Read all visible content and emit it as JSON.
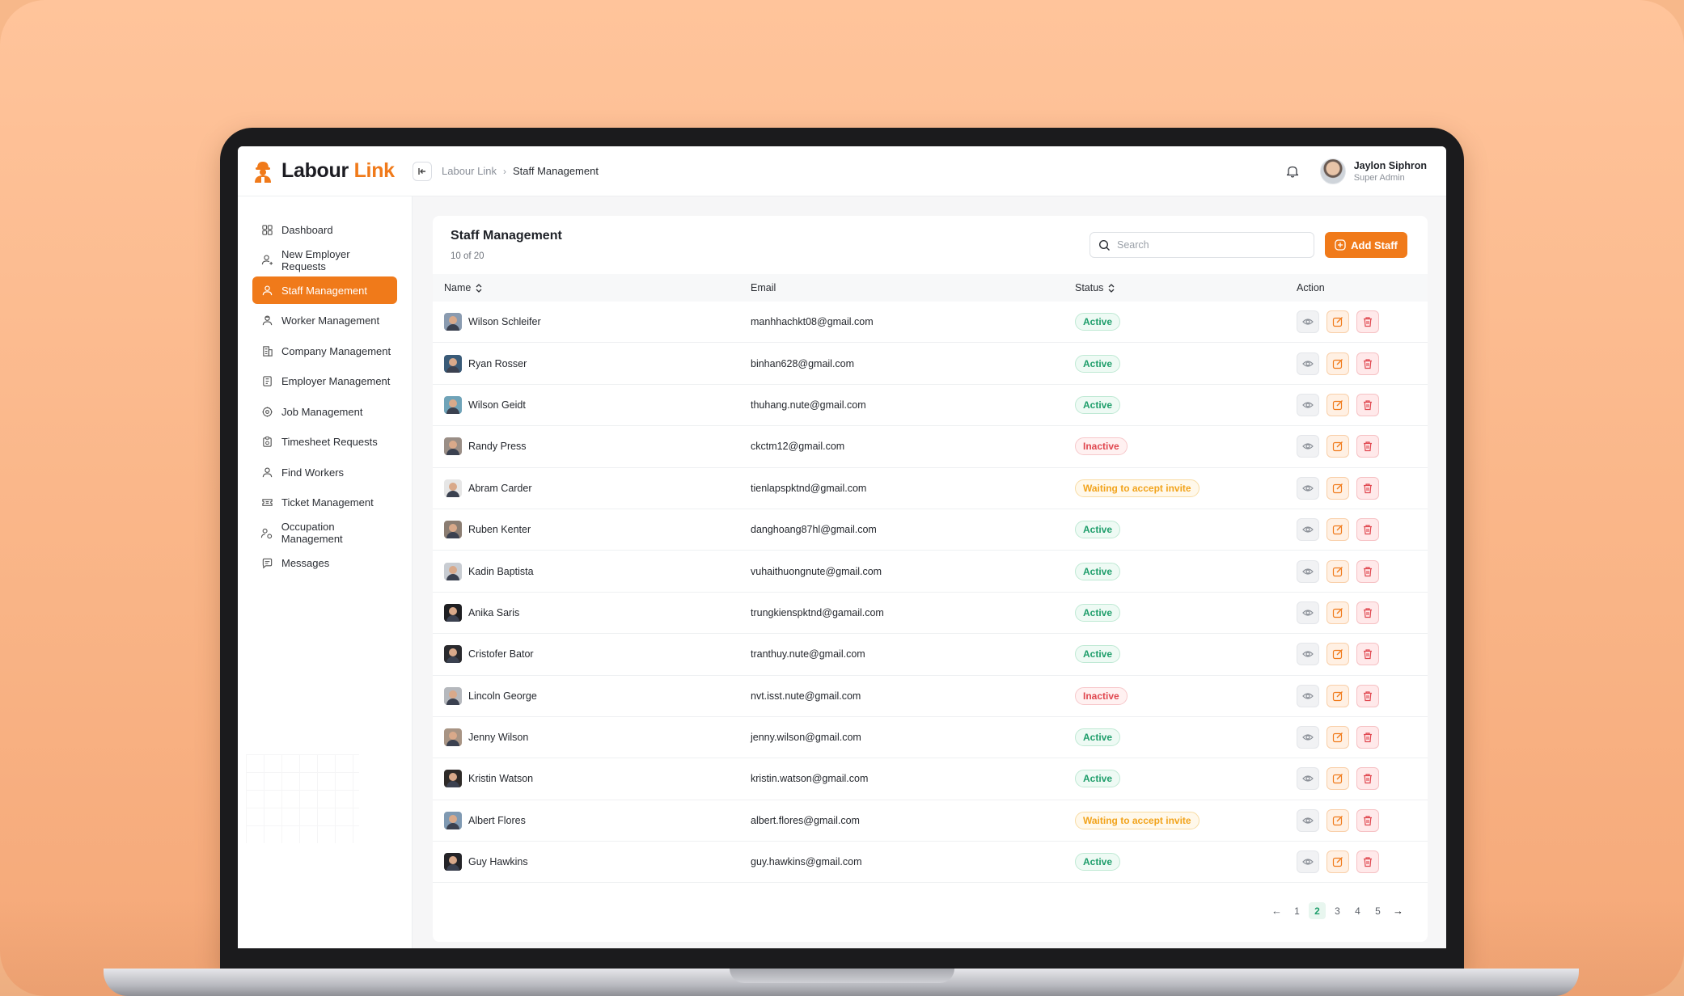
{
  "brand": {
    "name_main": "Labour ",
    "name_accent": "Link",
    "accent_color": "#f07a1a"
  },
  "breadcrumb": {
    "root": "Labour Link",
    "separator": "›",
    "current": "Staff Management"
  },
  "user": {
    "name": "Jaylon Siphron",
    "role": "Super Admin"
  },
  "sidebar": {
    "items": [
      {
        "label": "Dashboard",
        "icon": "dashboard-icon",
        "active": false
      },
      {
        "label": "New Employer Requests",
        "icon": "user-plus-icon",
        "active": false
      },
      {
        "label": "Staff Management",
        "icon": "staff-icon",
        "active": true
      },
      {
        "label": "Worker Management",
        "icon": "worker-icon",
        "active": false
      },
      {
        "label": "Company Management",
        "icon": "building-icon",
        "active": false
      },
      {
        "label": "Employer Management",
        "icon": "briefcase-icon",
        "active": false
      },
      {
        "label": "Job Management",
        "icon": "job-icon",
        "active": false
      },
      {
        "label": "Timesheet Requests",
        "icon": "clipboard-icon",
        "active": false
      },
      {
        "label": "Find Workers",
        "icon": "user-icon",
        "active": false
      },
      {
        "label": "Ticket Management",
        "icon": "ticket-icon",
        "active": false
      },
      {
        "label": "Occupation Management",
        "icon": "occupation-icon",
        "active": false
      },
      {
        "label": "Messages",
        "icon": "message-icon",
        "active": false
      }
    ]
  },
  "main": {
    "title": "Staff Management",
    "count_text": "10 of 20",
    "search_placeholder": "Search",
    "add_button": "Add Staff",
    "columns": {
      "name": "Name",
      "email": "Email",
      "status": "Status",
      "action": "Action"
    },
    "rows": [
      {
        "name": "Wilson Schleifer",
        "email": "manhhachkt08@gmail.com",
        "status": "Active",
        "status_type": "active",
        "avatar_color": "#8a9bb0"
      },
      {
        "name": "Ryan Rosser",
        "email": "binhan628@gmail.com",
        "status": "Active",
        "status_type": "active",
        "avatar_color": "#3a5b78"
      },
      {
        "name": "Wilson Geidt",
        "email": "thuhang.nute@gmail.com",
        "status": "Active",
        "status_type": "active",
        "avatar_color": "#6fa3b8"
      },
      {
        "name": "Randy Press",
        "email": "ckctm12@gmail.com",
        "status": "Inactive",
        "status_type": "inactive",
        "avatar_color": "#9a8e86"
      },
      {
        "name": "Abram Carder",
        "email": "tienlapspktnd@gmail.com",
        "status": "Waiting to accept invite",
        "status_type": "waiting",
        "avatar_color": "#e6e6e6"
      },
      {
        "name": "Ruben Kenter",
        "email": "danghoang87hl@gmail.com",
        "status": "Active",
        "status_type": "active",
        "avatar_color": "#8b7d72"
      },
      {
        "name": "Kadin Baptista",
        "email": "vuhaithuongnute@gmail.com",
        "status": "Active",
        "status_type": "active",
        "avatar_color": "#c8ccd2"
      },
      {
        "name": "Anika Saris",
        "email": "trungkienspktnd@gamail.com",
        "status": "Active",
        "status_type": "active",
        "avatar_color": "#1f1f22"
      },
      {
        "name": "Cristofer Bator",
        "email": "tranthuy.nute@gmail.com",
        "status": "Active",
        "status_type": "active",
        "avatar_color": "#2a2a2e"
      },
      {
        "name": "Lincoln George",
        "email": "nvt.isst.nute@gmail.com",
        "status": "Inactive",
        "status_type": "inactive",
        "avatar_color": "#b5b8bd"
      },
      {
        "name": "Jenny Wilson",
        "email": "jenny.wilson@gmail.com",
        "status": "Active",
        "status_type": "active",
        "avatar_color": "#a89484"
      },
      {
        "name": "Kristin Watson",
        "email": "kristin.watson@gmail.com",
        "status": "Active",
        "status_type": "active",
        "avatar_color": "#2e2a28"
      },
      {
        "name": "Albert Flores",
        "email": "albert.flores@gmail.com",
        "status": "Waiting to accept invite",
        "status_type": "waiting",
        "avatar_color": "#7f99b2"
      },
      {
        "name": "Guy Hawkins",
        "email": "guy.hawkins@gmail.com",
        "status": "Active",
        "status_type": "active",
        "avatar_color": "#242428"
      }
    ]
  },
  "pagination": {
    "prev": "←",
    "pages": [
      "1",
      "2",
      "3",
      "4",
      "5"
    ],
    "current": "2",
    "next": "→"
  }
}
